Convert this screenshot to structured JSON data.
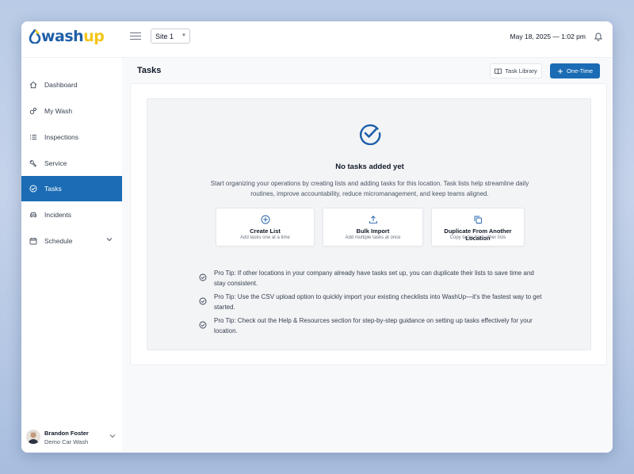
{
  "brand": {
    "wash": "wash",
    "up": "up"
  },
  "topbar": {
    "site_value": "Site 1",
    "datetime": "May 18, 2025 — 1:02 pm"
  },
  "sidebar": {
    "items": [
      {
        "label": "Dashboard",
        "icon": "home-icon"
      },
      {
        "label": "My Wash",
        "icon": "bubbles-icon"
      },
      {
        "label": "Inspections",
        "icon": "list-icon"
      },
      {
        "label": "Service",
        "icon": "wrench-icon"
      },
      {
        "label": "Tasks",
        "icon": "check-circle-icon",
        "active": true
      },
      {
        "label": "Incidents",
        "icon": "car-icon"
      },
      {
        "label": "Schedule",
        "icon": "calendar-icon"
      }
    ],
    "user": {
      "name": "Brandon Foster",
      "org": "Demo Car Wash"
    }
  },
  "main": {
    "title": "Tasks",
    "task_library_label": "Task Library",
    "one_time_label": "One-Time",
    "empty_title": "No tasks added yet",
    "empty_desc": "Start organizing your operations by creating lists and adding tasks for this location. Task lists help streamline daily routines, improve accountability, reduce micromanagement, and keep teams aligned.",
    "actions": [
      {
        "title": "Create List",
        "sub": "Add tasks one at a time",
        "icon": "plus-circle-icon"
      },
      {
        "title": "Bulk Import",
        "sub": "Add multiple tasks at once",
        "icon": "upload-icon"
      },
      {
        "title": "Duplicate From Another Location",
        "sub": "Copy tasks from other lists",
        "icon": "copy-icon"
      }
    ],
    "tips": [
      "Pro Tip: If other locations in your company already have tasks set up, you can duplicate their lists to save time and stay consistent.",
      "Pro Tip: Use the CSV upload option to quickly import your existing checklists into WashUp—it's the fastest way to get started.",
      "Pro Tip: Check out the Help & Resources section for step-by-step guidance on setting up tasks effectively for your location."
    ]
  },
  "colors": {
    "primary": "#1b6cb5",
    "brand_blue": "#1e5fa8",
    "brand_yellow": "#f5c518"
  }
}
